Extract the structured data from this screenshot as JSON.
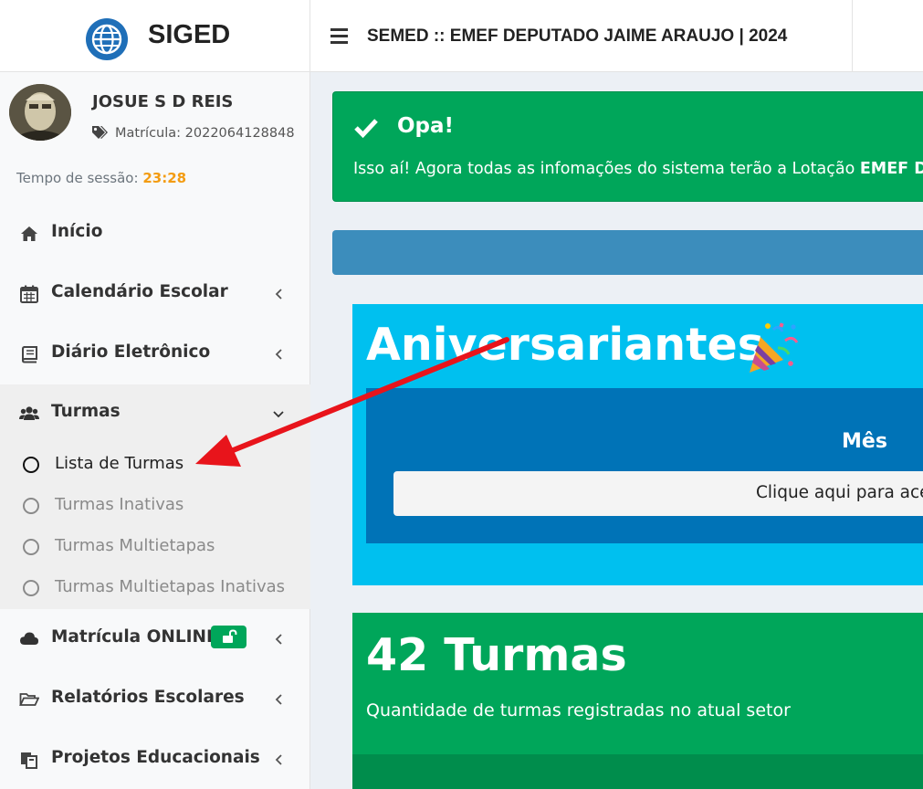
{
  "app": {
    "logo_text": "SIGED",
    "page_title": "SEMED :: EMEF DEPUTADO JAIME ARAUJO | 2024"
  },
  "user": {
    "name": "JOSUE S D REIS",
    "matricula_label": "Matrícula: 2022064128848",
    "session_label": "Tempo de sessão:",
    "session_time": "23:28"
  },
  "sidebar": {
    "items": [
      {
        "label": "Início",
        "icon": "home-icon"
      },
      {
        "label": "Calendário Escolar",
        "icon": "calendar-icon"
      },
      {
        "label": "Diário Eletrônico",
        "icon": "book-icon"
      },
      {
        "label": "Turmas",
        "icon": "users-icon",
        "expanded": true
      },
      {
        "label": "Matrícula ONLINE",
        "icon": "cloud-icon",
        "badge_icon": "unlock-icon"
      },
      {
        "label": "Relatórios Escolares",
        "icon": "folder-open-icon"
      },
      {
        "label": "Projetos Educacionais",
        "icon": "copy-icon"
      }
    ],
    "turmas_submenu": [
      {
        "label": "Lista de Turmas",
        "active": true
      },
      {
        "label": "Turmas Inativas",
        "active": false
      },
      {
        "label": "Turmas Multietapas",
        "active": false
      },
      {
        "label": "Turmas Multietapas Inativas",
        "active": false
      }
    ]
  },
  "alert": {
    "title": "Opa!",
    "text": "Isso aí! Agora todas as infomações do sistema terão a Lotação ",
    "text_bold": "EMEF DEPUTADO JAIME ARAUJO",
    "color": "#00a65a"
  },
  "birthdays": {
    "title": "Aniversariantes",
    "emoji_icon": "party-popper-icon",
    "month_label": "Mês",
    "button_label": "Clique aqui para acessar"
  },
  "turmas_stat": {
    "count_label": "42 Turmas",
    "description": "Quantidade de turmas registradas no atual setor"
  },
  "colors": {
    "success": "#00a65a",
    "info": "#00c0ef",
    "primary": "#3c8dbc",
    "primary_dark": "#0073b7",
    "session_time": "#f39c12",
    "annotation": "#e8141b"
  }
}
